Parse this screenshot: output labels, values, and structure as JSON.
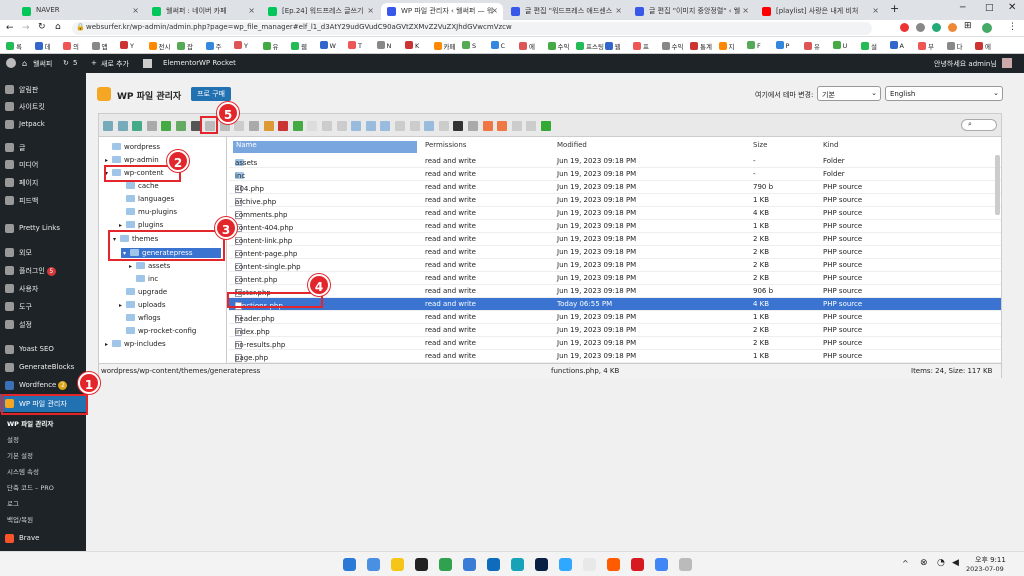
{
  "tabs": [
    {
      "label": "NAVER",
      "color": "#03c75a"
    },
    {
      "label": "웰써퍼 : 네이버 카페",
      "color": "#03c75a"
    },
    {
      "label": "[Ep.24] 워드프레스 글쓰기",
      "color": "#03c75a"
    },
    {
      "label": "WP 파일 관리자 ‹ 웰써퍼 — 워",
      "color": "#3858e9"
    },
    {
      "label": "글 편집 \"워드프레스 애드센스",
      "color": "#3858e9"
    },
    {
      "label": "글 편집 \"이미지 중앙정렬\" ‹ 웰",
      "color": "#3858e9"
    },
    {
      "label": "[playlist] 사랑은 내게 비처",
      "color": "#ff0000"
    }
  ],
  "address": "websurfer.kr/wp-admin/admin.php?page=wp_file_manager#elf_l1_d3AtY29udGVudC90aGVtZXMvZ2VuZXJhdGVwcmVzcw",
  "bookmarks": [
    "록",
    "데",
    "의",
    "앱",
    "Y",
    "전시",
    "잡",
    "주",
    "Y",
    "유",
    "웹",
    "W",
    "T",
    "N",
    "K",
    "카페",
    "S",
    "C",
    "에",
    "수익",
    "프스팅",
    "웹",
    "프",
    "수익",
    "통계",
    "지",
    "F",
    "P",
    "유",
    "U",
    "설",
    "A",
    "부",
    "다",
    "에"
  ],
  "adminbar": {
    "site": "웰써피",
    "updates": "5",
    "new": "새로 추가",
    "elementor": "Elementor",
    "rocket": "WP Rocket",
    "greeting": "안녕하세요 admin님"
  },
  "sidebar": {
    "items": [
      "알림판",
      "사이트킷",
      "Jetpack",
      "글",
      "미디어",
      "페이지",
      "피드백",
      "Pretty Links",
      "외모",
      "플러그인",
      "사용자",
      "도구",
      "설정",
      "Yoast SEO",
      "GenerateBlocks",
      "Wordfence",
      "WP 파일 관리자"
    ],
    "plugin_badge": "5",
    "wordfence_badge": "2",
    "submenu": [
      "WP 파일 관리자",
      "설정",
      "기본 설정",
      "시스템 속성",
      "단축 코드 – PRO",
      "로그",
      "백업/복원"
    ],
    "brave": "Brave"
  },
  "header": {
    "title": "WP 파일 관리자",
    "buy": "프로 구매",
    "theme_label": "여기에서 테마 변경:",
    "theme_value": "기본",
    "lang_value": "English"
  },
  "tree": [
    "wordpress",
    "wp-admin",
    "wp-content",
    "cache",
    "languages",
    "mu-plugins",
    "plugins",
    "themes",
    "generatepress",
    "assets",
    "inc",
    "upgrade",
    "uploads",
    "wflogs",
    "wp-rocket-config",
    "wp-includes"
  ],
  "columns": {
    "name": "Name",
    "perm": "Permissions",
    "mod": "Modified",
    "size": "Size",
    "kind": "Kind"
  },
  "files": [
    {
      "name": "assets",
      "perm": "read and write",
      "mod": "Jun 19, 2023 09:18 PM",
      "size": "-",
      "kind": "Folder",
      "dir": true
    },
    {
      "name": "inc",
      "perm": "read and write",
      "mod": "Jun 19, 2023 09:18 PM",
      "size": "-",
      "kind": "Folder",
      "dir": true
    },
    {
      "name": "404.php",
      "perm": "read and write",
      "mod": "Jun 19, 2023 09:18 PM",
      "size": "790 b",
      "kind": "PHP source"
    },
    {
      "name": "archive.php",
      "perm": "read and write",
      "mod": "Jun 19, 2023 09:18 PM",
      "size": "1 KB",
      "kind": "PHP source"
    },
    {
      "name": "comments.php",
      "perm": "read and write",
      "mod": "Jun 19, 2023 09:18 PM",
      "size": "4 KB",
      "kind": "PHP source"
    },
    {
      "name": "content-404.php",
      "perm": "read and write",
      "mod": "Jun 19, 2023 09:18 PM",
      "size": "1 KB",
      "kind": "PHP source"
    },
    {
      "name": "content-link.php",
      "perm": "read and write",
      "mod": "Jun 19, 2023 09:18 PM",
      "size": "2 KB",
      "kind": "PHP source"
    },
    {
      "name": "content-page.php",
      "perm": "read and write",
      "mod": "Jun 19, 2023 09:18 PM",
      "size": "2 KB",
      "kind": "PHP source"
    },
    {
      "name": "content-single.php",
      "perm": "read and write",
      "mod": "Jun 19, 2023 09:18 PM",
      "size": "2 KB",
      "kind": "PHP source"
    },
    {
      "name": "content.php",
      "perm": "read and write",
      "mod": "Jun 19, 2023 09:18 PM",
      "size": "2 KB",
      "kind": "PHP source"
    },
    {
      "name": "footer.php",
      "perm": "read and write",
      "mod": "Jun 19, 2023 09:18 PM",
      "size": "906 b",
      "kind": "PHP source"
    },
    {
      "name": "functions.php",
      "perm": "read and write",
      "mod": "Today 06:55 PM",
      "size": "4 KB",
      "kind": "PHP source",
      "selected": true
    },
    {
      "name": "header.php",
      "perm": "read and write",
      "mod": "Jun 19, 2023 09:18 PM",
      "size": "1 KB",
      "kind": "PHP source"
    },
    {
      "name": "index.php",
      "perm": "read and write",
      "mod": "Jun 19, 2023 09:18 PM",
      "size": "2 KB",
      "kind": "PHP source"
    },
    {
      "name": "no-results.php",
      "perm": "read and write",
      "mod": "Jun 19, 2023 09:18 PM",
      "size": "2 KB",
      "kind": "PHP source"
    },
    {
      "name": "page.php",
      "perm": "read and write",
      "mod": "Jun 19, 2023 09:18 PM",
      "size": "1 KB",
      "kind": "PHP source"
    }
  ],
  "status": {
    "path": "wordpress/wp-content/themes/generatepress",
    "selected": "functions.php, 4 KB",
    "total": "Items: 24, Size: 117 KB"
  },
  "steps": [
    "1",
    "2",
    "3",
    "4",
    "5"
  ],
  "clock": {
    "time": "오후 9:11",
    "date": "2023-07-09"
  },
  "colors": {
    "accent": "#2271b1",
    "selection": "#3a74d0",
    "annotation": "#e3262b"
  }
}
